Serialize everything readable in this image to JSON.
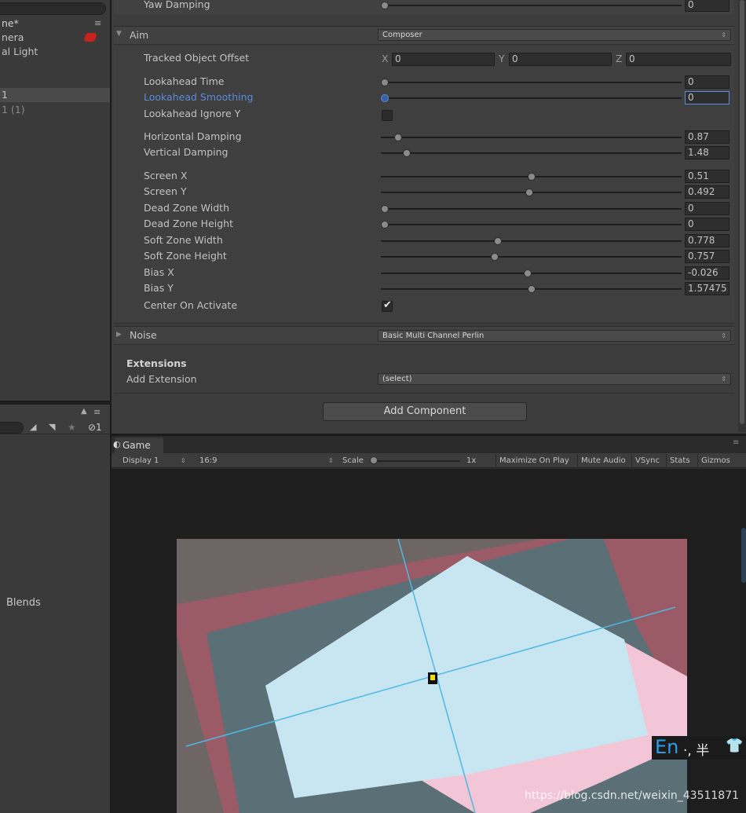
{
  "hierarchy": {
    "scene_name": "ne*",
    "menu_icon": "≡",
    "items": [
      "nera",
      "al Light",
      "1",
      "1 (1)"
    ]
  },
  "project": {
    "lock_icon": "🔒",
    "menu_icon": "≡",
    "label": "Blends"
  },
  "inspector": {
    "yaw_damping": {
      "label": "Yaw Damping",
      "value": "0",
      "fraction": 0.0
    },
    "aim": {
      "label": "Aim",
      "dropdown": "Composer"
    },
    "tracked_object_offset": {
      "label": "Tracked Object Offset",
      "x_label": "X",
      "x": "0",
      "y_label": "Y",
      "y": "0",
      "z_label": "Z",
      "z": "0"
    },
    "sliders": [
      {
        "label": "Lookahead Time",
        "value": "0",
        "fraction": 0.0
      },
      {
        "label": "Lookahead Smoothing",
        "value": "0",
        "fraction": 0.0,
        "highlight": true
      },
      {
        "label": "Horizontal Damping",
        "value": "0.87",
        "fraction": 0.045
      },
      {
        "label": "Vertical Damping",
        "value": "1.48",
        "fraction": 0.074
      },
      {
        "label": "Screen X",
        "value": "0.51",
        "fraction": 0.5
      },
      {
        "label": "Screen Y",
        "value": "0.492",
        "fraction": 0.492
      },
      {
        "label": "Dead Zone Width",
        "value": "0",
        "fraction": 0.0
      },
      {
        "label": "Dead Zone Height",
        "value": "0",
        "fraction": 0.0
      },
      {
        "label": "Soft Zone Width",
        "value": "0.778",
        "fraction": 0.385
      },
      {
        "label": "Soft Zone Height",
        "value": "0.757",
        "fraction": 0.375
      },
      {
        "label": "Bias X",
        "value": "-0.026",
        "fraction": 0.487
      },
      {
        "label": "Bias Y",
        "value": "1.57475",
        "fraction": 0.5
      }
    ],
    "lookahead_ignore_y": {
      "label": "Lookahead Ignore Y",
      "checked": false
    },
    "center_on_activate": {
      "label": "Center On Activate",
      "checked": true
    },
    "noise": {
      "label": "Noise",
      "dropdown": "Basic Multi Channel Perlin"
    },
    "extensions": {
      "title": "Extensions",
      "add_label": "Add Extension",
      "dropdown": "(select)"
    },
    "add_component": "Add Component",
    "highlight_color": "#5b8bd9"
  },
  "game": {
    "tab": "Game",
    "display": "Display 1",
    "aspect": "16:9",
    "scale_label": "Scale",
    "scale_value": "1x",
    "maximize": "Maximize On Play",
    "mute": "Mute Audio",
    "vsync": "VSync",
    "stats": "Stats",
    "gizmos": "Gizmos"
  },
  "overlay": {
    "ime_lang": "En",
    "ime_extra": "·, 半",
    "watermark": "https://blog.csdn.net/weixin_43511871"
  }
}
